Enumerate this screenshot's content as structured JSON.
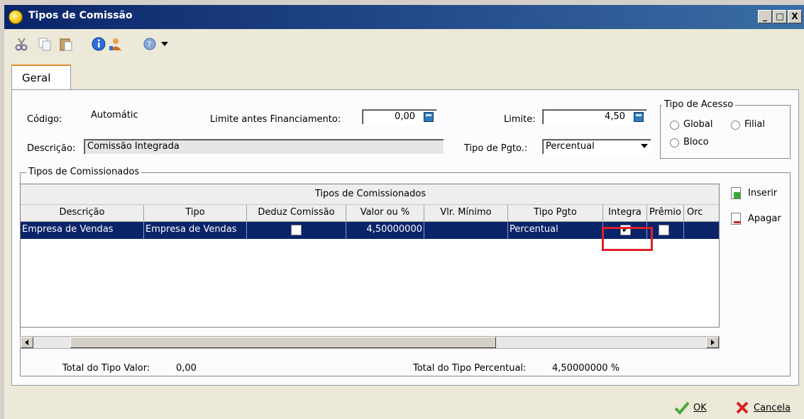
{
  "window": {
    "title": "Tipos de Comissão",
    "min": "_",
    "max": "□",
    "close": "X"
  },
  "toolbar": {
    "icons": [
      "cut-icon",
      "copy-icon",
      "paste-icon",
      "info-icon",
      "users-icon",
      "help-icon",
      "dropdown-icon"
    ]
  },
  "tabs": [
    {
      "label": "Geral"
    }
  ],
  "form": {
    "codigo_label": "Código:",
    "codigo_value": "Automátic",
    "limite_fin_label": "Limite antes Financiamento:",
    "limite_fin_value": "0,00",
    "limite_label": "Limite:",
    "limite_value": "4,50",
    "descricao_label": "Descrição:",
    "descricao_value": "Comissão Integrada",
    "tipo_pgto_label": "Tipo de Pgto.:",
    "tipo_pgto_value": "Percentual"
  },
  "tipo_acesso": {
    "legend": "Tipo de Acesso",
    "options": [
      "Global",
      "Filial",
      "Bloco"
    ]
  },
  "comissionados": {
    "legend": "Tipos de Comissionados",
    "super_header": "Tipos de Comissionados",
    "columns": [
      "Descrição",
      "Tipo",
      "Deduz Comissão",
      "Valor ou %",
      "Vlr. Mínimo",
      "Tipo Pgto",
      "Integra",
      "Prêmio",
      "Orc"
    ],
    "rows": [
      {
        "descricao": "Empresa de Vendas",
        "tipo": "Empresa de Vendas",
        "deduz": false,
        "valor": "4,50000000",
        "vlr_min": "",
        "tipo_pgto": "Percentual",
        "integra": true,
        "premio": false
      }
    ],
    "side_buttons": {
      "inserir": "Inserir",
      "apagar": "Apagar"
    },
    "total_valor_label": "Total do Tipo Valor:",
    "total_valor": "0,00",
    "total_percentual_label": "Total do Tipo Percentual:",
    "total_percentual": "4,50000000 %"
  },
  "footer": {
    "ok": "OK",
    "cancel": "Cancela"
  },
  "colors": {
    "title_bar": "#0a246a",
    "selection": "#0a246a",
    "highlight": "#e0202a",
    "tab_accent": "#e68b2c"
  }
}
